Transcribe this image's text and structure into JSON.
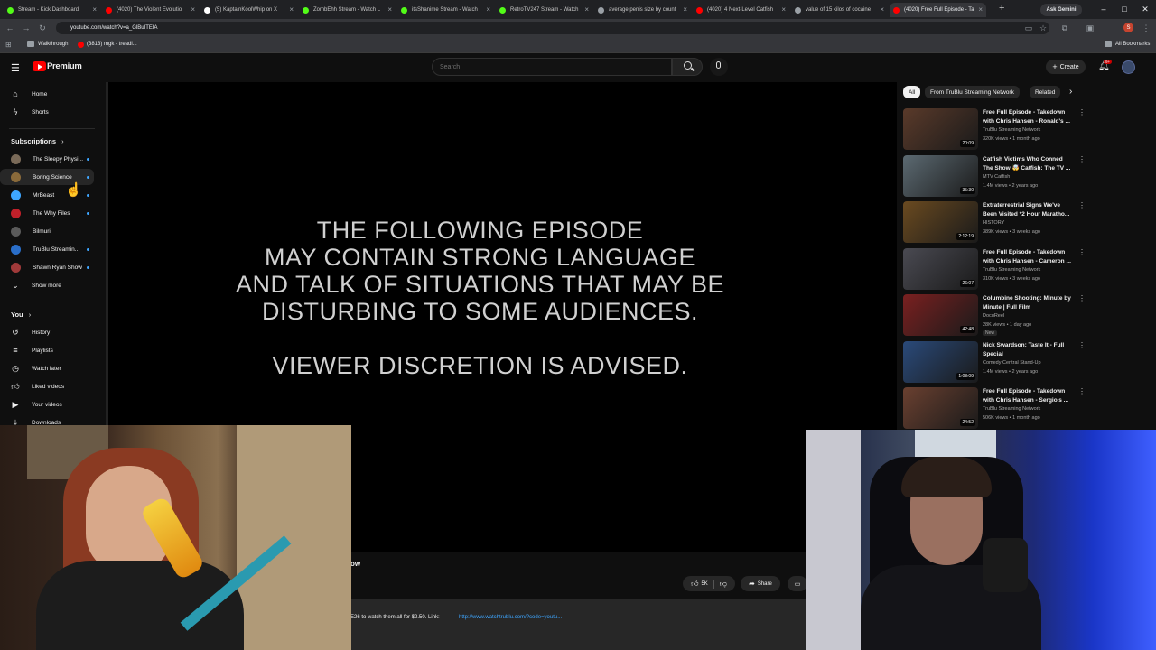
{
  "browser": {
    "tabs": [
      {
        "label": "Stream - Kick Dashboard",
        "color": "#53fc18"
      },
      {
        "label": "(4020) The Violent Evolutio",
        "color": "#ff0000"
      },
      {
        "label": "(5) KaptainKoolWhip on X",
        "color": "#ffffff"
      },
      {
        "label": "ZombEhh Stream - Watch L",
        "color": "#53fc18"
      },
      {
        "label": "itsShanime Stream - Watch",
        "color": "#53fc18"
      },
      {
        "label": "RetroTV247 Stream - Watch",
        "color": "#53fc18"
      },
      {
        "label": "average penis size by count",
        "color": "#9aa0a6"
      },
      {
        "label": "(4020) 4 Next-Level Catfish",
        "color": "#ff0000"
      },
      {
        "label": "value of 15 kilos of cocaine",
        "color": "#9aa0a6"
      },
      {
        "label": "(4020) Free Full Episode - Ta",
        "color": "#ff0000"
      }
    ],
    "new_tab": "+",
    "ask_gemini": "Ask Gemini",
    "url": "youtube.com/watch?v=a_GlBuITEIA",
    "bookmarks": [
      "Walkthrough",
      "(3813) mgk - treadi..."
    ],
    "all_bookmarks": "All Bookmarks",
    "window_controls": [
      "–",
      "□",
      "✕"
    ]
  },
  "youtube": {
    "logo_text": "Premium",
    "search_placeholder": "Search",
    "create_label": "Create",
    "notification_count": "9+",
    "sidebar": {
      "top": [
        {
          "label": "Home",
          "icon": "home-icon"
        },
        {
          "label": "Shorts",
          "icon": "shorts-icon"
        }
      ],
      "subscriptions_title": "Subscriptions",
      "subscriptions": [
        {
          "label": "The Sleepy Physi...",
          "color": "#7a6a58"
        },
        {
          "label": "Boring Science",
          "color": "#8a6a3a"
        },
        {
          "label": "MrBeast",
          "color": "#3ea6ff"
        },
        {
          "label": "The Why Files",
          "color": "#c0202a"
        },
        {
          "label": "Bilmuri",
          "color": "#5a5a5a"
        },
        {
          "label": "TruBlu Streamin...",
          "color": "#2a6ec8"
        },
        {
          "label": "Shawn Ryan Show",
          "color": "#a03a3a"
        }
      ],
      "show_more": "Show more",
      "you_title": "You",
      "you_items": [
        {
          "label": "History",
          "icon": "history-icon"
        },
        {
          "label": "Playlists",
          "icon": "playlists-icon"
        },
        {
          "label": "Watch later",
          "icon": "watch-later-icon"
        },
        {
          "label": "Liked videos",
          "icon": "liked-videos-icon"
        },
        {
          "label": "Your videos",
          "icon": "your-videos-icon"
        },
        {
          "label": "Downloads",
          "icon": "downloads-icon"
        }
      ]
    },
    "player_text": {
      "line1": "THE FOLLOWING EPISODE",
      "line2": "MAY CONTAIN STRONG LANGUAGE",
      "line3": "AND TALK OF SITUATIONS THAT MAY BE",
      "line4": "DISTURBING TO SOME AUDIENCES.",
      "line5": "VIEWER DISCRETION IS ADVISED."
    },
    "title_fragment": "ow",
    "like_count": "5K",
    "share_label": "Share",
    "description_fragment": "E26 to watch them all for $2.50.  Link:",
    "description_link": "http://www.watchtrublu.com/?code=youtu...",
    "chips": [
      "All",
      "From TruBlu Streaming Network",
      "Related"
    ],
    "related": [
      {
        "title": "Free Full Episode - Takedown with Chris Hansen - Ronald's ...",
        "channel": "TruBlu Streaming Network",
        "meta": "320K views • 1 month ago",
        "duration": "20:09",
        "thumb": "#5a3a2a"
      },
      {
        "title": "Catfish Victims Who Conned The Show 🤯 Catfish: The TV ...",
        "channel": "MTV Catfish",
        "meta": "1.4M views • 2 years ago",
        "duration": "35:30",
        "thumb": "#5c6a72"
      },
      {
        "title": "Extraterrestrial Signs We've Been Visited *2 Hour Maratho...",
        "channel": "HISTORY",
        "meta": "389K views • 3 weeks ago",
        "duration": "2:12:19",
        "thumb": "#6a4a20"
      },
      {
        "title": "Free Full Episode - Takedown with Chris Hansen - Cameron ...",
        "channel": "TruBlu Streaming Network",
        "meta": "310K views • 3 weeks ago",
        "duration": "26:07",
        "thumb": "#4a4a52"
      },
      {
        "title": "Columbine Shooting: Minute by Minute | Full Film",
        "channel": "DocuReel",
        "meta": "28K views • 1 day ago",
        "duration": "42:48",
        "badge": "New",
        "thumb": "#7a2020"
      },
      {
        "title": "Nick Swardson: Taste It - Full Special",
        "channel": "Comedy Central Stand-Up",
        "meta": "1.4M views • 2 years ago",
        "duration": "1:08:09",
        "thumb": "#2a4a7a"
      },
      {
        "title": "Free Full Episode - Takedown with Chris Hansen - Sergio's ...",
        "channel": "TruBlu Streaming Network",
        "meta": "506K views • 1 month ago",
        "duration": "24:52",
        "thumb": "#6a4030"
      }
    ]
  }
}
